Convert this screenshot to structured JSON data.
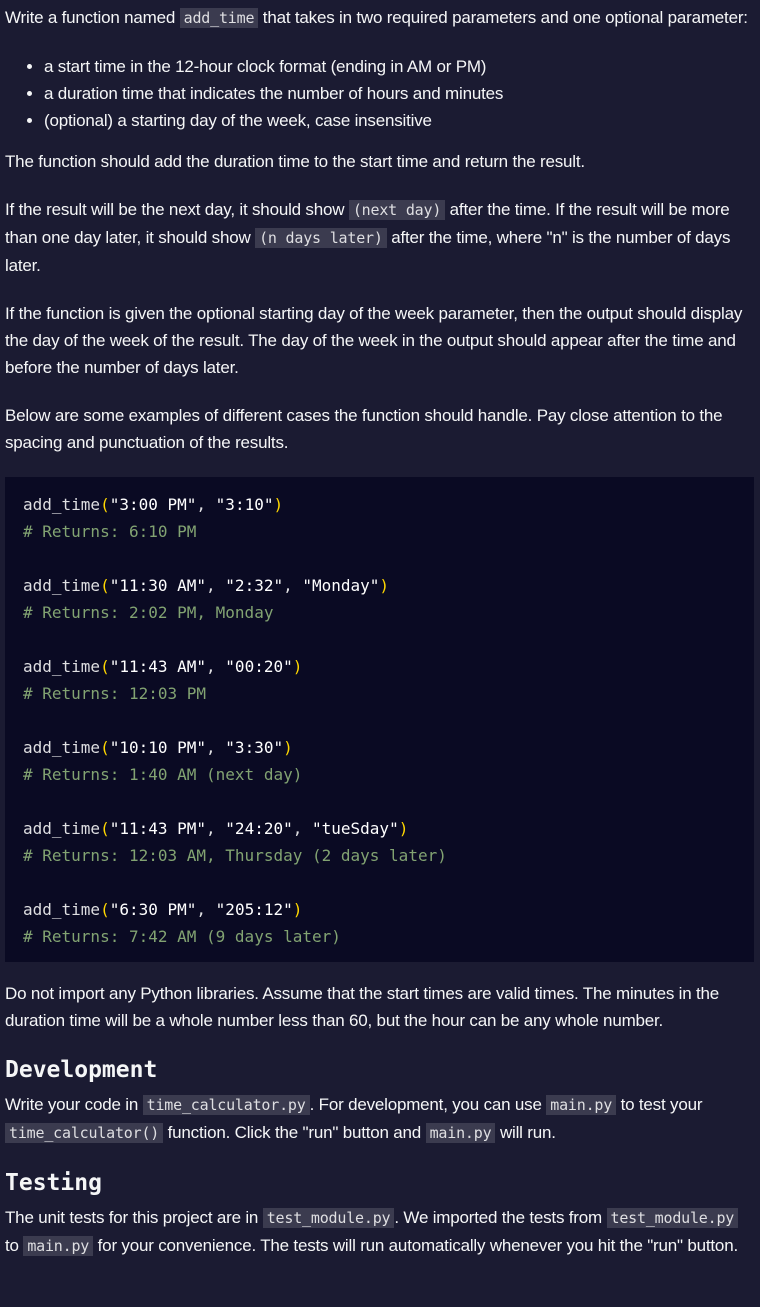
{
  "intro": {
    "before": "Write a function named ",
    "code": "add_time",
    "after": " that takes in two required parameters and one optional parameter:"
  },
  "params": [
    "a start time in the 12-hour clock format (ending in AM or PM)",
    "a duration time that indicates the number of hours and minutes",
    "(optional) a starting day of the week, case insensitive"
  ],
  "p_add": "The function should add the duration time to the start time and return the result.",
  "p_nextday": {
    "t1": "If the result will be the next day, it should show ",
    "c1": "(next day)",
    "t2": " after the time. If the result will be more than one day later, it should show ",
    "c2": "(n days later)",
    "t3": " after the time, where \"n\" is the number of days later."
  },
  "p_weekday": "If the function is given the optional starting day of the week parameter, then the output should display the day of the week of the result. The day of the week in the output should appear after the time and before the number of days later.",
  "p_examples": "Below are some examples of different cases the function should handle. Pay close attention to the spacing and punctuation of the results.",
  "examples": [
    {
      "fn": "add_time",
      "args": [
        "\"3:00 PM\"",
        "\"3:10\""
      ],
      "comment": "# Returns: 6:10 PM"
    },
    {
      "fn": "add_time",
      "args": [
        "\"11:30 AM\"",
        "\"2:32\"",
        "\"Monday\""
      ],
      "comment": "# Returns: 2:02 PM, Monday"
    },
    {
      "fn": "add_time",
      "args": [
        "\"11:43 AM\"",
        "\"00:20\""
      ],
      "comment": "# Returns: 12:03 PM"
    },
    {
      "fn": "add_time",
      "args": [
        "\"10:10 PM\"",
        "\"3:30\""
      ],
      "comment": "# Returns: 1:40 AM (next day)"
    },
    {
      "fn": "add_time",
      "args": [
        "\"11:43 PM\"",
        "\"24:20\"",
        "\"tueSday\""
      ],
      "comment": "# Returns: 12:03 AM, Thursday (2 days later)"
    },
    {
      "fn": "add_time",
      "args": [
        "\"6:30 PM\"",
        "\"205:12\""
      ],
      "comment": "# Returns: 7:42 AM (9 days later)"
    }
  ],
  "p_noimport": "Do not import any Python libraries. Assume that the start times are valid times. The minutes in the duration time will be a whole number less than 60, but the hour can be any whole number.",
  "development": {
    "heading": "Development",
    "t1": "Write your code in ",
    "c1": "time_calculator.py",
    "t2": ". For development, you can use ",
    "c2": "main.py",
    "t3": " to test your ",
    "c3": "time_calculator()",
    "t4": " function. Click the \"run\" button and ",
    "c4": "main.py",
    "t5": " will run."
  },
  "testing": {
    "heading": "Testing",
    "t1": "The unit tests for this project are in ",
    "c1": "test_module.py",
    "t2": ". We imported the tests from ",
    "c2": "test_module.py",
    "t3": " to ",
    "c3": "main.py",
    "t4": " for your convenience. The tests will run automatically whenever you hit the \"run\" button."
  }
}
